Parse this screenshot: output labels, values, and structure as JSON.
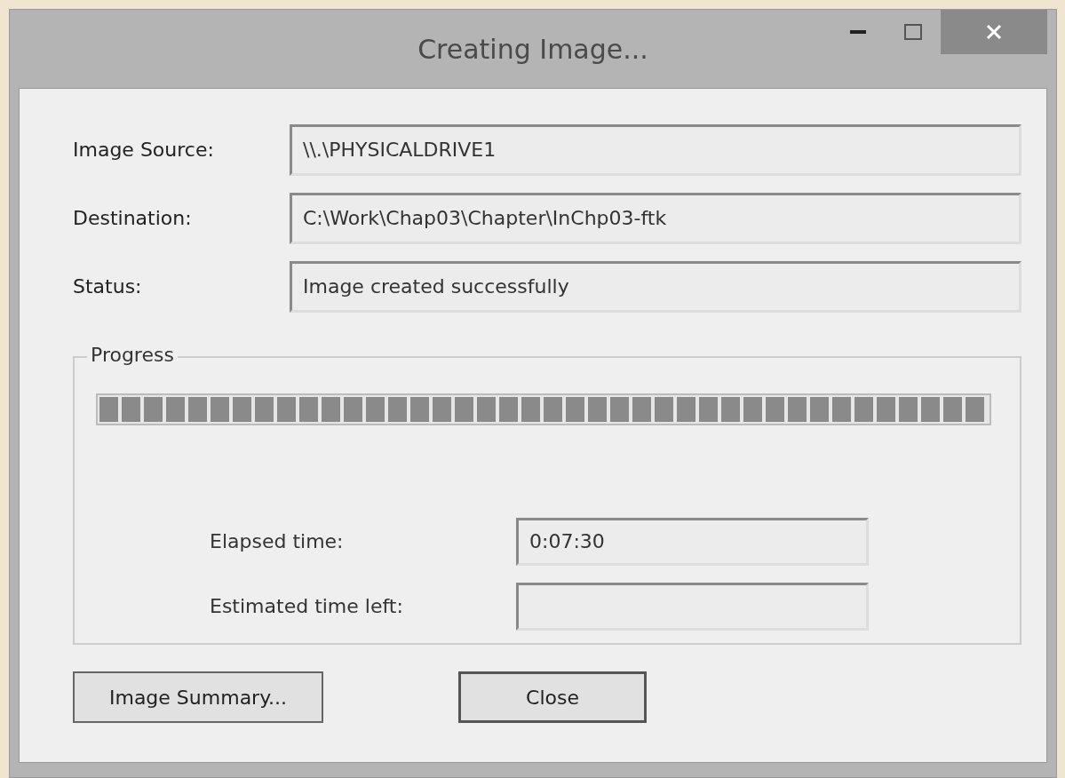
{
  "window": {
    "title": "Creating Image..."
  },
  "fields": [
    {
      "label": "Image Source:",
      "value": "\\\\.\\PHYSICALDRIVE1"
    },
    {
      "label": "Destination:",
      "value": "C:\\Work\\Chap03\\Chapter\\InChp03-ftk"
    },
    {
      "label": "Status:",
      "value": "Image created successfully"
    }
  ],
  "progress": {
    "title": "Progress",
    "level": 1.0,
    "times": [
      {
        "label": "Elapsed time:",
        "value": "0:07:30"
      },
      {
        "label": "Estimated time left:"
      }
    ]
  },
  "buttons": [
    "Image Summary...",
    "Close"
  ]
}
